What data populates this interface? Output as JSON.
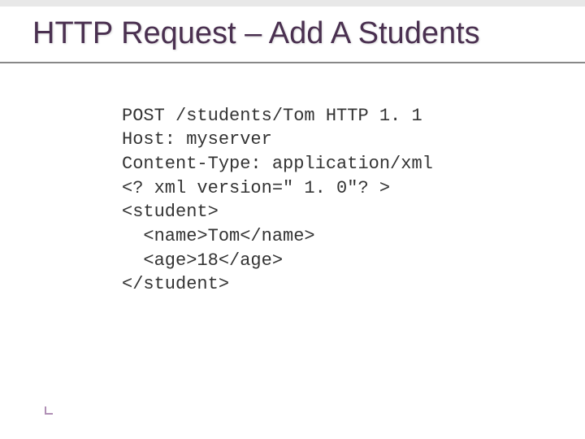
{
  "slide": {
    "title": "HTTP Request – Add A Students"
  },
  "code": {
    "line1": "POST /students/Tom HTTP 1. 1",
    "line2": "Host: myserver",
    "line3": "Content-Type: application/xml",
    "line4": "<? xml version=\" 1. 0\"? >",
    "line5": "<student>",
    "line6": "  <name>Tom</name>",
    "line7": "  <age>18</age>",
    "line8": "</student>"
  }
}
